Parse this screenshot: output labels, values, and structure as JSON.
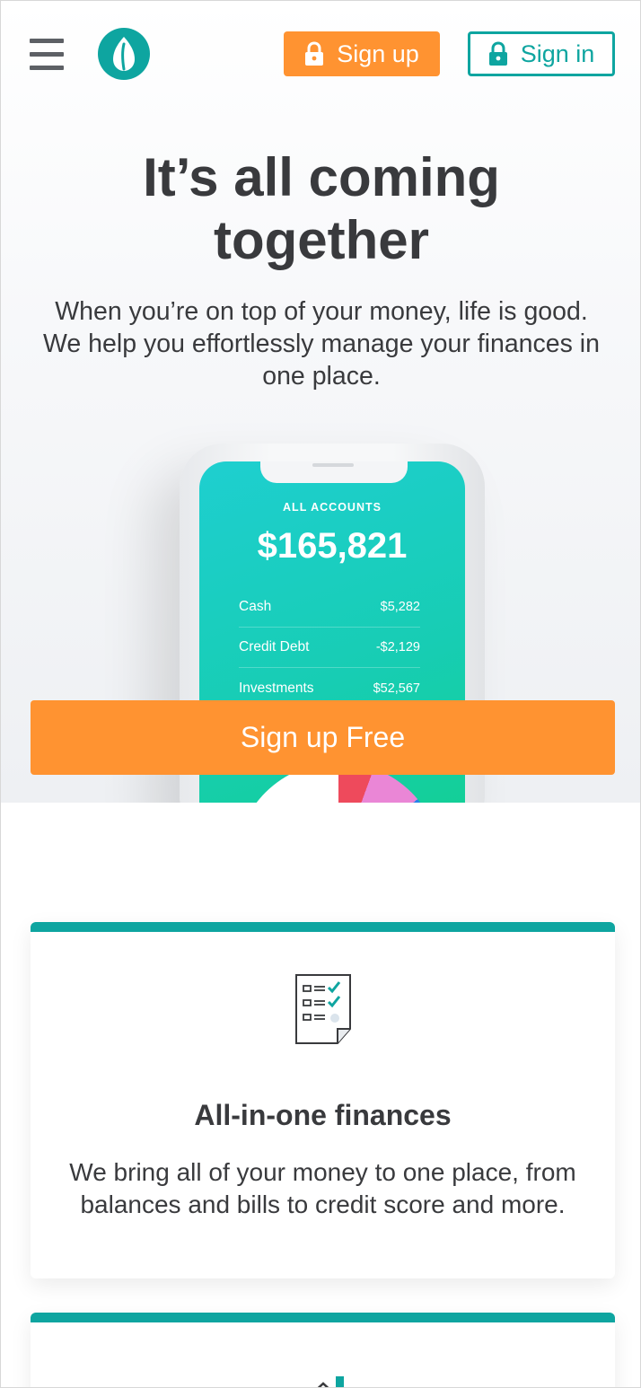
{
  "header": {
    "signup_label": "Sign up",
    "signin_label": "Sign in",
    "colors": {
      "accent": "#0ea5a0",
      "orange": "#ff9331"
    }
  },
  "hero": {
    "title": "It’s all coming together",
    "subtitle": "When you’re on top of your money, life is good. We help you effortlessly manage your finances in one place.",
    "cta_label": "Sign up Free"
  },
  "phone": {
    "accounts_label": "ALL ACCOUNTS",
    "total": "$165,821",
    "rows": [
      {
        "label": "Cash",
        "value": "$5,282"
      },
      {
        "label": "Credit Debt",
        "value": "-$2,129"
      },
      {
        "label": "Investments",
        "value": "$52,567"
      }
    ]
  },
  "features": [
    {
      "icon": "checklist-icon",
      "title": "All-in-one finances",
      "text": "We bring all of your money to one place, from balances and bills to credit score and more."
    },
    {
      "icon": "house-icon"
    }
  ]
}
